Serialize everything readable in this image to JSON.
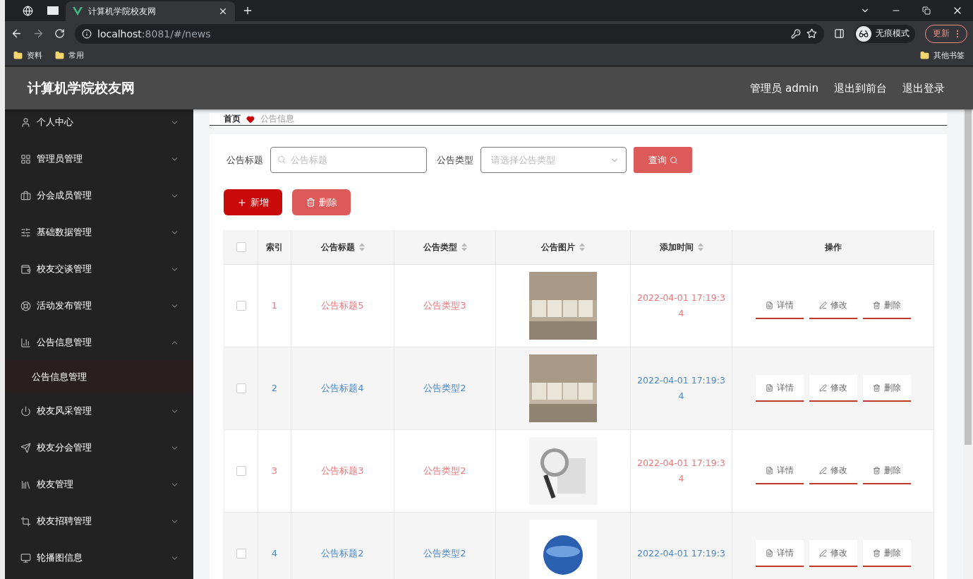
{
  "browser": {
    "tabs": [
      {
        "title": "计算机学院校友网",
        "selected": true
      }
    ],
    "url_host": "localhost",
    "url_rest": ":8081/#/news",
    "profile": "无痕模式",
    "update_button": "更新",
    "bookmarks": [
      "资料",
      "常用"
    ],
    "other_bookmarks": "其他书签"
  },
  "header": {
    "title": "计算机学院校友网",
    "links": [
      "管理员 admin",
      "退出到前台",
      "退出登录"
    ]
  },
  "sidebar": {
    "items": [
      {
        "label": "个人中心",
        "expanded": false
      },
      {
        "label": "管理员管理",
        "expanded": false
      },
      {
        "label": "分会成员管理",
        "expanded": false
      },
      {
        "label": "基础数据管理",
        "expanded": false
      },
      {
        "label": "校友交谈管理",
        "expanded": false
      },
      {
        "label": "活动发布管理",
        "expanded": false
      },
      {
        "label": "公告信息管理",
        "expanded": true,
        "children": [
          {
            "label": "公告信息管理",
            "selected": true
          }
        ]
      },
      {
        "label": "校友风采管理",
        "expanded": false
      },
      {
        "label": "校友分会管理",
        "expanded": false
      },
      {
        "label": "校友管理",
        "expanded": false
      },
      {
        "label": "校友招聘管理",
        "expanded": false
      },
      {
        "label": "轮播图信息",
        "expanded": false
      }
    ]
  },
  "breadcrumb": [
    "首页",
    "公告信息"
  ],
  "filters": [
    {
      "label": "公告标题",
      "kind": "text",
      "placeholder": "公告标题"
    },
    {
      "label": "公告类型",
      "kind": "select",
      "placeholder": "请选择公告类型"
    }
  ],
  "query_button": "查询",
  "actions": [
    {
      "label": "新增",
      "kind": "add"
    },
    {
      "label": "删除",
      "kind": "delete"
    }
  ],
  "table": {
    "select_all_checked": false,
    "columns": [
      {
        "label": "索引",
        "sortable": false
      },
      {
        "label": "公告标题",
        "sortable": true
      },
      {
        "label": "公告类型",
        "sortable": true
      },
      {
        "label": "公告图片",
        "sortable": true
      },
      {
        "label": "添加时间",
        "sortable": true
      },
      {
        "label": "操作",
        "sortable": false
      }
    ],
    "rows": [
      {
        "index": "1",
        "title": "公告标题5",
        "type": "公告类型3",
        "image": {
          "kind": "picture"
        },
        "time": "2022-04-01 17:19:34",
        "color": "#e8777a",
        "checked": false,
        "buttons": [
          "详情",
          "修改",
          "删除"
        ]
      },
      {
        "index": "2",
        "title": "公告标题4",
        "type": "公告类型2",
        "image": {
          "kind": "picture"
        },
        "time": "2022-04-01 17:19:34",
        "color": "#4d88c8",
        "checked": false,
        "buttons": [
          "详情",
          "修改",
          "删除"
        ]
      },
      {
        "index": "3",
        "title": "公告标题3",
        "type": "公告类型2",
        "image": {
          "kind": "picture"
        },
        "time": "2022-04-01 17:19:34",
        "color": "#e8777a",
        "checked": false,
        "buttons": [
          "详情",
          "修改",
          "删除"
        ]
      },
      {
        "index": "4",
        "title": "公告标题2",
        "type": "公告类型2",
        "image": {
          "kind": "picture"
        },
        "time": "2022-04-01 17:19:3",
        "color": "#4d88c8",
        "checked": false,
        "buttons": [
          "详情",
          "修改",
          "删除"
        ]
      }
    ]
  }
}
